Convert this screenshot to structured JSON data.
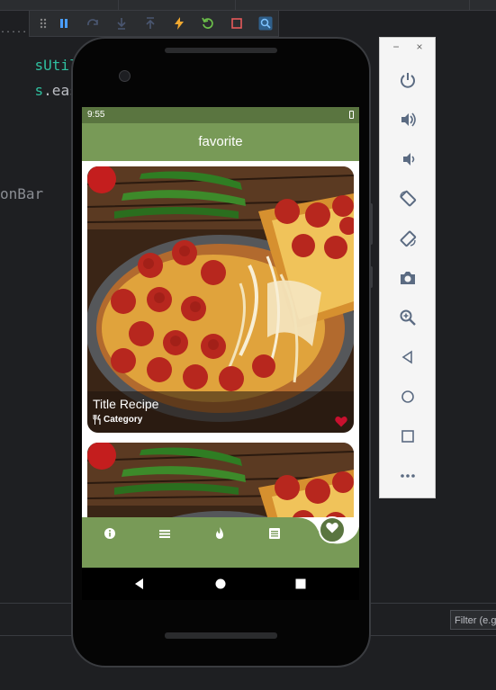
{
  "editor": {
    "line1_class": "sUtilite",
    "line2_prefix": "s",
    "line2_rest": ".easeI",
    "line3": "onBar",
    "top_fragment": "......"
  },
  "emulator_toolbar": {
    "icons": [
      "drag-handle-icon",
      "pause-icon",
      "step-over-icon",
      "step-into-icon",
      "step-out-icon",
      "hot-reload-icon",
      "hot-restart-icon",
      "stop-icon",
      "inspect-icon"
    ]
  },
  "app": {
    "status_time": "9:55",
    "appbar_title": "favorite",
    "cards": [
      {
        "title": "Title Recipe",
        "category": "Category",
        "favorited": true
      },
      {
        "title": "",
        "category": "",
        "favorited": false
      }
    ],
    "bottom_nav": [
      "info-icon",
      "menu-icon",
      "fire-icon",
      "list-icon"
    ],
    "fab_icon": "heart-icon",
    "accent_color": "#789a57",
    "dark_accent_color": "#5a7540",
    "fav_color": "#c8102e"
  },
  "system_nav": [
    "back-icon",
    "home-icon",
    "recents-icon"
  ],
  "emulator_panel": {
    "window_controls": [
      "−",
      "×"
    ],
    "controls": [
      "power-icon",
      "volume-up-icon",
      "volume-down-icon",
      "rotate-left-icon",
      "rotate-right-icon",
      "camera-icon",
      "zoom-icon",
      "back-icon",
      "home-icon",
      "overview-icon",
      "more-icon"
    ]
  },
  "filter": {
    "placeholder": "Filter (e.g"
  }
}
